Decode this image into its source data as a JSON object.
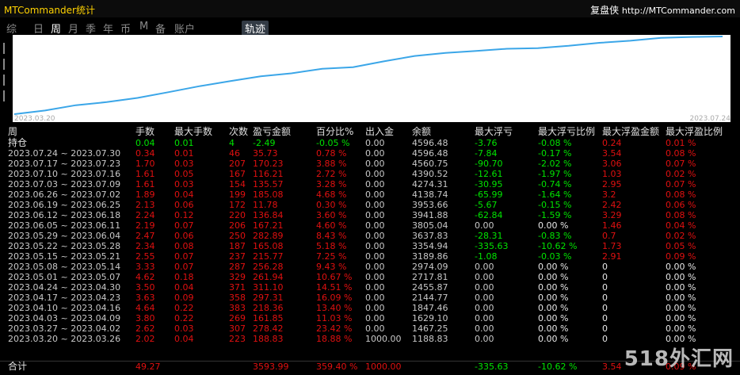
{
  "window": {
    "title": "MTCommander统计",
    "brand": "复盘侠",
    "url": "http://MTCommander.com"
  },
  "tabs": [
    "综",
    "日",
    "周",
    "月",
    "季",
    "年",
    "币",
    "M",
    "备",
    "账户"
  ],
  "active_tab": "周",
  "trajectory_button": "轨迹",
  "chart": {
    "start_date": "2023.03.20",
    "end_date": "2023.07.24",
    "line_color": "#3ba6e8",
    "values": [
      0,
      188.83,
      467.25,
      629.1,
      847.46,
      1144.77,
      1455.87,
      1717.81,
      1974.09,
      2128.55,
      2369.6,
      2448.35,
      2753.48,
      3030.85,
      3195.36,
      3296.69,
      3410.17,
      3441.69,
      3562.81,
      3718.54,
      3826.8,
      3980.34,
      4024.39,
      4049.33
    ]
  },
  "headers": [
    "周",
    "手数",
    "最大手数",
    "次数",
    "盈亏金额",
    "百分比%",
    "出入金",
    "余额",
    "最大浮亏",
    "最大浮亏比例",
    "最大浮盈金额",
    "最大浮盈比例"
  ],
  "holding": {
    "label": "持仓",
    "cells": [
      "0.04",
      "0.01",
      "4",
      "-2.49",
      "-0.05 %",
      "0.00",
      "4596.48",
      "-3.76",
      "-0.08 %",
      "0.24",
      "0.01 %"
    ]
  },
  "rows": [
    {
      "period": "2023.07.24 ~ 2023.07.30",
      "cells": [
        "0.34",
        "0.01",
        "46",
        "35.73",
        "0.78 %",
        "0.00",
        "4596.48",
        "-7.84",
        "-0.17 %",
        "3.54",
        "0.08 %"
      ]
    },
    {
      "period": "2023.07.17 ~ 2023.07.23",
      "cells": [
        "1.70",
        "0.03",
        "207",
        "170.23",
        "3.88 %",
        "0.00",
        "4560.75",
        "-90.70",
        "-2.02 %",
        "3.06",
        "0.07 %"
      ]
    },
    {
      "period": "2023.07.10 ~ 2023.07.16",
      "cells": [
        "1.61",
        "0.05",
        "167",
        "116.21",
        "2.72 %",
        "0.00",
        "4390.52",
        "-12.61",
        "-1.97 %",
        "1.03",
        "0.02 %"
      ]
    },
    {
      "period": "2023.07.03 ~ 2023.07.09",
      "cells": [
        "1.61",
        "0.03",
        "154",
        "135.57",
        "3.28 %",
        "0.00",
        "4274.31",
        "-30.95",
        "-0.74 %",
        "2.95",
        "0.07 %"
      ]
    },
    {
      "period": "2023.06.26 ~ 2023.07.02",
      "cells": [
        "1.89",
        "0.04",
        "199",
        "185.08",
        "4.68 %",
        "0.00",
        "4138.74",
        "-65.99",
        "-1.64 %",
        "3.2",
        "0.08 %"
      ]
    },
    {
      "period": "2023.06.19 ~ 2023.06.25",
      "cells": [
        "2.13",
        "0.06",
        "172",
        "11.78",
        "0.30 %",
        "0.00",
        "3953.66",
        "-5.67",
        "-0.15 %",
        "2.42",
        "0.06 %"
      ]
    },
    {
      "period": "2023.06.12 ~ 2023.06.18",
      "cells": [
        "2.24",
        "0.12",
        "220",
        "136.84",
        "3.60 %",
        "0.00",
        "3941.88",
        "-62.84",
        "-1.59 %",
        "3.29",
        "0.08 %"
      ]
    },
    {
      "period": "2023.06.05 ~ 2023.06.11",
      "cells": [
        "2.19",
        "0.07",
        "206",
        "167.21",
        "4.60 %",
        "0.00",
        "3805.04",
        "0.00",
        "0.00 %",
        "1.46",
        "0.04 %"
      ]
    },
    {
      "period": "2023.05.29 ~ 2023.06.04",
      "cells": [
        "2.47",
        "0.06",
        "250",
        "282.89",
        "8.43 %",
        "0.00",
        "3637.83",
        "-28.31",
        "-0.83 %",
        "0.7",
        "0.02 %"
      ]
    },
    {
      "period": "2023.05.22 ~ 2023.05.28",
      "cells": [
        "2.34",
        "0.08",
        "187",
        "165.08",
        "5.18 %",
        "0.00",
        "3354.94",
        "-335.63",
        "-10.62 %",
        "1.73",
        "0.05 %"
      ]
    },
    {
      "period": "2023.05.15 ~ 2023.05.21",
      "cells": [
        "2.55",
        "0.07",
        "237",
        "215.77",
        "7.25 %",
        "0.00",
        "3189.86",
        "-1.08",
        "-0.03 %",
        "2.91",
        "0.09 %"
      ]
    },
    {
      "period": "2023.05.08 ~ 2023.05.14",
      "cells": [
        "3.33",
        "0.07",
        "287",
        "256.28",
        "9.43 %",
        "0.00",
        "2974.09",
        "0.00",
        "0.00 %",
        "0",
        "0.00 %"
      ]
    },
    {
      "period": "2023.05.01 ~ 2023.05.07",
      "cells": [
        "4.62",
        "0.18",
        "329",
        "261.94",
        "10.67 %",
        "0.00",
        "2717.81",
        "0.00",
        "0.00 %",
        "0",
        "0.00 %"
      ]
    },
    {
      "period": "2023.04.24 ~ 2023.04.30",
      "cells": [
        "3.50",
        "0.04",
        "371",
        "311.10",
        "14.51 %",
        "0.00",
        "2455.87",
        "0.00",
        "0.00 %",
        "0",
        "0.00 %"
      ]
    },
    {
      "period": "2023.04.17 ~ 2023.04.23",
      "cells": [
        "3.63",
        "0.09",
        "358",
        "297.31",
        "16.09 %",
        "0.00",
        "2144.77",
        "0.00",
        "0.00 %",
        "0",
        "0.00 %"
      ]
    },
    {
      "period": "2023.04.10 ~ 2023.04.16",
      "cells": [
        "4.64",
        "0.22",
        "383",
        "218.36",
        "13.40 %",
        "0.00",
        "1847.46",
        "0.00",
        "0.00 %",
        "0",
        "0.00 %"
      ]
    },
    {
      "period": "2023.04.03 ~ 2023.04.09",
      "cells": [
        "3.80",
        "0.22",
        "269",
        "161.85",
        "11.03 %",
        "0.00",
        "1629.10",
        "0.00",
        "0.00 %",
        "0",
        "0.00 %"
      ]
    },
    {
      "period": "2023.03.27 ~ 2023.04.02",
      "cells": [
        "2.62",
        "0.03",
        "307",
        "278.42",
        "23.42 %",
        "0.00",
        "1467.25",
        "0.00",
        "0.00 %",
        "0",
        "0.00 %"
      ]
    },
    {
      "period": "2023.03.20 ~ 2023.03.26",
      "cells": [
        "2.02",
        "0.04",
        "223",
        "188.83",
        "18.88 %",
        "1000.00",
        "1188.83",
        "0.00",
        "0.00 %",
        "0",
        "0.00 %"
      ]
    }
  ],
  "total": {
    "label": "合计",
    "cells": [
      "49.27",
      "",
      "",
      "3593.99",
      "359.40 %",
      "1000.00",
      "",
      "-335.63",
      "-10.62 %",
      "3.54",
      "0.09 %"
    ]
  },
  "watermark": "518外汇网",
  "colors": {
    "positive": "#e01010",
    "negative": "#00e400",
    "neutral": "#c8c8c8",
    "title": "#ffd200"
  }
}
